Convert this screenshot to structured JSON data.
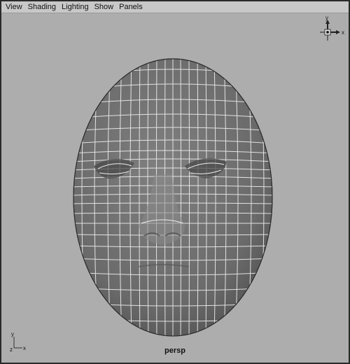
{
  "menubar": {
    "items": [
      {
        "label": "View"
      },
      {
        "label": "Shading"
      },
      {
        "label": "Lighting"
      },
      {
        "label": "Show"
      },
      {
        "label": "Panels"
      }
    ]
  },
  "viewport": {
    "camera": "persp",
    "view_cube": {
      "axes": {
        "y": "y",
        "x": "x"
      }
    },
    "axis_gizmo": {
      "y": "y",
      "z": "z",
      "x": "x"
    }
  },
  "colors": {
    "viewport_bg": "#adadad",
    "menubar_bg": "#c8c8c8",
    "mesh_fill": "#6e6e6e",
    "wireframe": "#f2f2f2"
  },
  "icons": [
    "view-cube-icon",
    "axis-gizmo-icon"
  ]
}
